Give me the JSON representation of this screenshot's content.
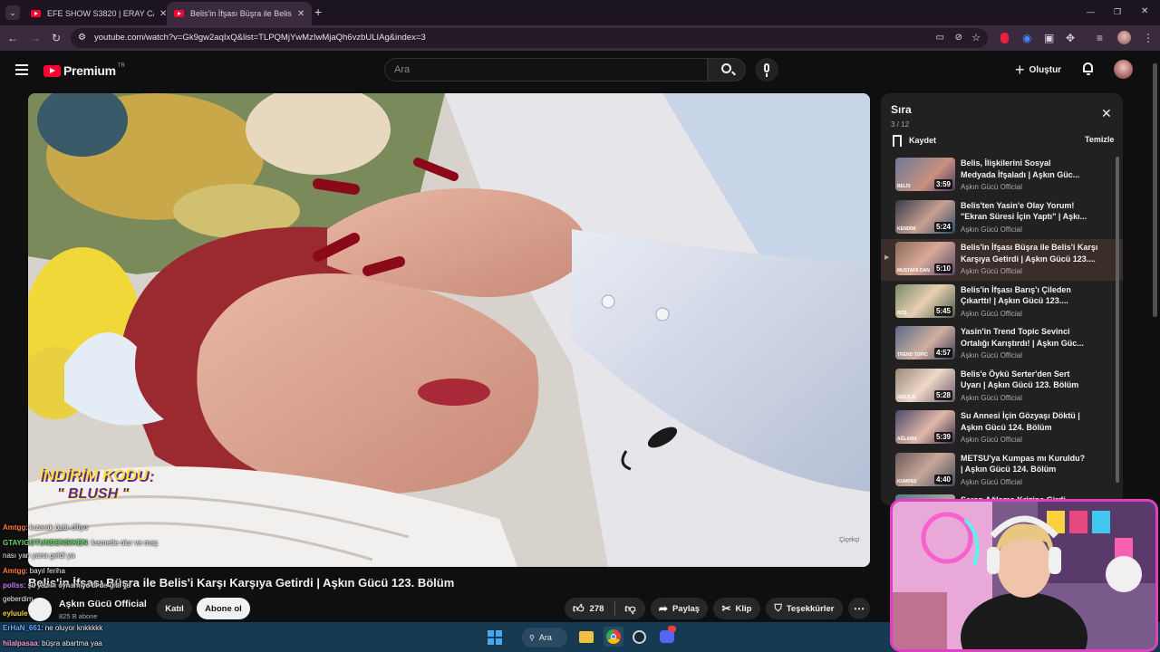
{
  "browser": {
    "tabs": [
      {
        "title": "EFE SHOW S3820 | ERAY CAN Ö",
        "close": "✕"
      },
      {
        "title": "Belis'in İfşası Büşra ile Belis'i Kar",
        "close": "✕"
      }
    ],
    "new_tab": "+",
    "url": "youtube.com/watch?v=Gk9gw2aqIxQ&list=TLPQMjYwMzIwMjaQh6vzbULIAg&index=3",
    "window_controls": [
      "—",
      "❐",
      "✕"
    ]
  },
  "header": {
    "logo_text": "Premium",
    "logo_badge": "TR",
    "search_placeholder": "Ara",
    "create_label": "Oluştur"
  },
  "player": {
    "overlay_line1": "İNDİRİM KODU:",
    "overlay_line2": "\" BLUSH \"",
    "watermark": "Çiçekçi"
  },
  "video": {
    "title": "Belis'in İfşası Büşra ile Belis'i Karşı Karşıya Getirdi | Aşkın Gücü 123. Bölüm",
    "channel": "Aşkın Gücü Official",
    "subscribers": "825 B abone",
    "join_label": "Katıl",
    "subscribe_label": "Abone ol",
    "likes": "278",
    "share_label": "Paylaş",
    "clip_label": "Klip",
    "thanks_label": "Teşekkürler"
  },
  "playlist": {
    "title": "Sıra",
    "position": "3 / 12",
    "save_label": "Kaydet",
    "clear_label": "Temizle",
    "items": [
      {
        "title": "Belis, İlişkilerini Sosyal\nMedyada İfşaladı | Aşkın Güc...",
        "channel": "Aşkın Gücü Official",
        "duration": "3:59",
        "thumb_caption": "BELİS"
      },
      {
        "title": "Belis'ten Yasin'e Olay Yorum!\n\"Ekran Süresi İçin Yaptı\" | Aşkı...",
        "channel": "Aşkın Gücü Official",
        "duration": "5:24",
        "thumb_caption": "KENDİNİ"
      },
      {
        "title": "Belis'in İfşası Büşra ile Belis'i Karşı\nKarşıya Getirdi | Aşkın Gücü 123....",
        "channel": "Aşkın Gücü Official",
        "duration": "5:10",
        "thumb_caption": "MUSTAFA DAN"
      },
      {
        "title": "Belis'in İfşası Barış'ı Çileden\nÇıkarttı! | Aşkın Gücü 123....",
        "channel": "Aşkın Gücü Official",
        "duration": "5:45",
        "thumb_caption": "BÖŞ"
      },
      {
        "title": "Yasin'in Trend Topic Sevinci\nOrtalığı Karıştırdı! | Aşkın Güc...",
        "channel": "Aşkın Gücü Official",
        "duration": "4:57",
        "thumb_caption": "TREND TOPIC"
      },
      {
        "title": "Belis'e Öykü Serter'den Sert\nUyarı | Aşkın Gücü 123. Bölüm",
        "channel": "Aşkın Gücü Official",
        "duration": "5:28",
        "thumb_caption": "GİZLİLİK"
      },
      {
        "title": "Su Annesi İçin Gözyaşı Döktü |\nAşkın Gücü 124. Bölüm",
        "channel": "Aşkın Gücü Official",
        "duration": "5:39",
        "thumb_caption": "AĞLAMA"
      },
      {
        "title": "METSU'ya Kumpas mı Kuruldu?\n| Aşkın Gücü 124. Bölüm",
        "channel": "Aşkın Gücü Official",
        "duration": "4:40",
        "thumb_caption": "KUMPAS"
      },
      {
        "title": "Serap Ağlama Krizine Girdi",
        "channel": "",
        "duration": "",
        "thumb_caption": ""
      }
    ]
  },
  "chat": [
    {
      "user": "Amtgg",
      "text": ": kızarak özür diliyo",
      "color": "#ff7a3c"
    },
    {
      "user": "GTAYIGOTUNDENSIKEN",
      "text": ": kısmetle olur ve maç",
      "color": "#6cd66c"
    },
    {
      "user": "",
      "text": "nası yan yana geldi ya",
      "color": "#ffffff"
    },
    {
      "user": "Amtgg",
      "text": ": bayıl feriha",
      "color": "#ff7a3c"
    },
    {
      "user": "pollss",
      "text": ": şu yazılıı oynamıyo bi de gitti ya",
      "color": "#c87aff"
    },
    {
      "user": "",
      "text": "geberdim",
      "color": "#ffffff"
    },
    {
      "user": "eyluule",
      "text": "",
      "color": "#f0d040"
    },
    {
      "user": "ErHaN_661",
      "text": ": ne oluyor knkkkkk",
      "color": "#60b0ff"
    },
    {
      "user": "hilalpasaa",
      "text": ": büşra abartma yaa",
      "color": "#ff9ad0"
    }
  ],
  "taskbar": {
    "search_label": "Ara"
  },
  "colors": {
    "yt_red": "#ff0033",
    "bg": "#0f0f0f",
    "subscribe_bg": "#f1f1f1",
    "webcam_border": "#e040c0"
  }
}
